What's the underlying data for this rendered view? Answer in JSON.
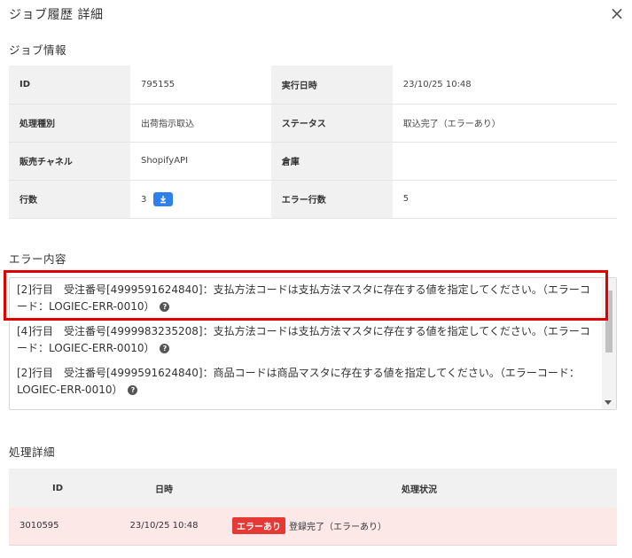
{
  "modal": {
    "title": "ジョブ履歴 詳細",
    "close_icon": "close-icon"
  },
  "job_info": {
    "section_title": "ジョブ情報",
    "rows": [
      {
        "label1": "ID",
        "value1": "795155",
        "label2": "実行日時",
        "value2": "23/10/25 10:48"
      },
      {
        "label1": "処理種別",
        "value1": "出荷指示取込",
        "label2": "ステータス",
        "value2": "取込完了（エラーあり）"
      },
      {
        "label1": "販売チャネル",
        "value1": "ShopifyAPI",
        "label2": "倉庫",
        "value2": ""
      },
      {
        "label1": "行数",
        "value1": "3",
        "label2": "エラー行数",
        "value2": "5"
      }
    ],
    "download_icon": "download-icon"
  },
  "errors": {
    "section_title": "エラー内容",
    "items": [
      "[2]行目　受注番号[4999591624840]：支払方法コードは支払方法マスタに存在する値を指定してください。（エラーコード：LOGIEC-ERR-0010）",
      "[4]行目　受注番号[4999983235208]：支払方法コードは支払方法マスタに存在する値を指定してください。（エラーコード：LOGIEC-ERR-0010）",
      "[2]行目　受注番号[4999591624840]：商品コードは商品マスタに存在する値を指定してください。（エラーコード：LOGIEC-ERR-0010）"
    ],
    "help_icon": "help-icon",
    "highlight_color": "#e00000"
  },
  "process": {
    "section_title": "処理詳細",
    "headers": [
      "ID",
      "日時",
      "処理状況"
    ],
    "rows": [
      {
        "id": "3010595",
        "datetime": "23/10/25 10:48",
        "badge": "エラーあり",
        "status": "登録完了（エラーあり）"
      }
    ],
    "badge_color": "#e53935",
    "row_bg": "#fde8e8"
  },
  "colors": {
    "accent": "#2f80ed",
    "label_bg": "#f1f1f1"
  }
}
